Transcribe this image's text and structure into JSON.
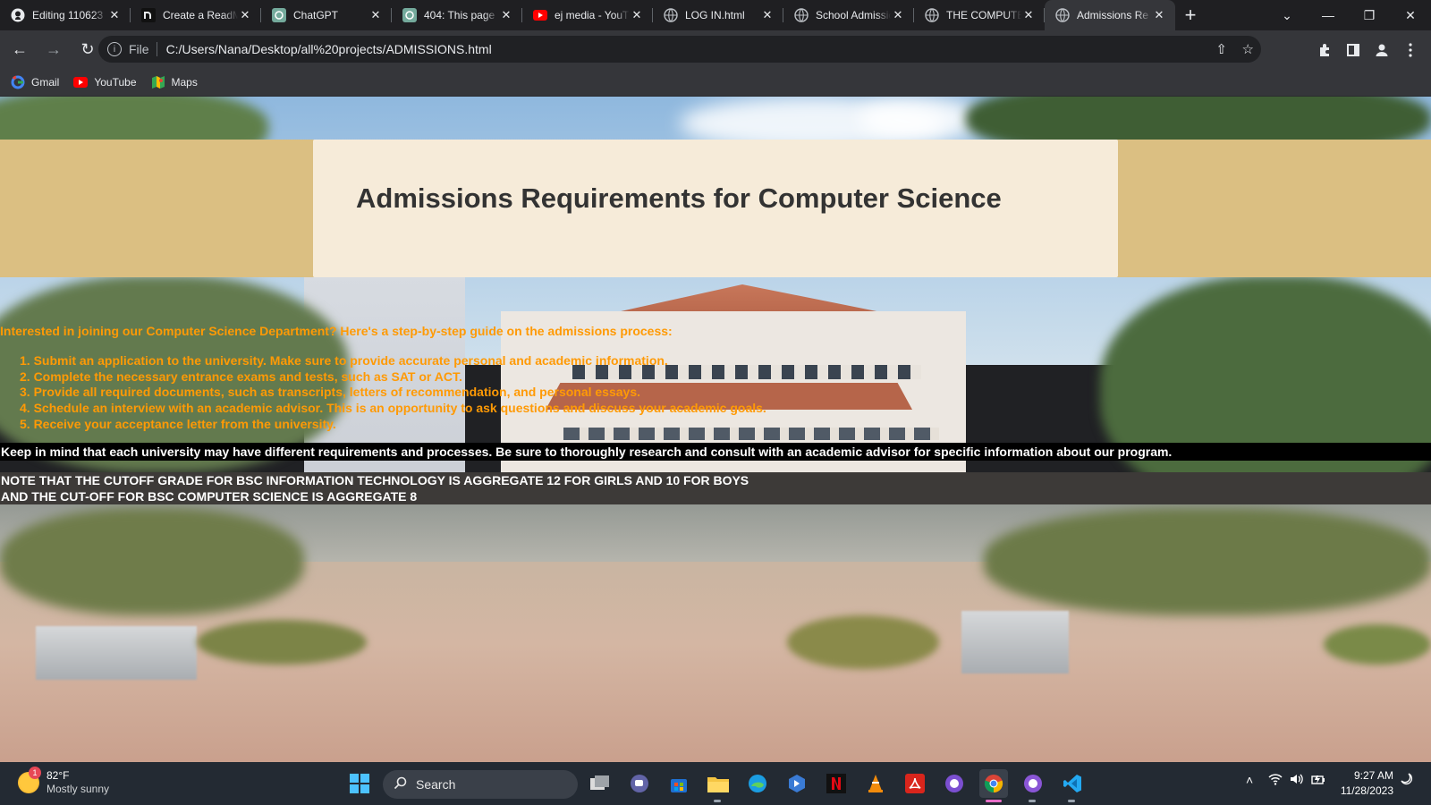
{
  "browser": {
    "tabs": [
      {
        "title": "Editing 110623",
        "favicon": "github-icon",
        "active": false
      },
      {
        "title": "Create a ReadMe",
        "favicon": "readme-icon",
        "active": false
      },
      {
        "title": "ChatGPT",
        "favicon": "chatgpt-icon",
        "active": false
      },
      {
        "title": "404: This page",
        "favicon": "chatgpt-icon",
        "active": false
      },
      {
        "title": "ej media - YouTube",
        "favicon": "youtube-icon",
        "active": false
      },
      {
        "title": "LOG IN.html",
        "favicon": "globe-icon",
        "active": false
      },
      {
        "title": "School Admission",
        "favicon": "globe-icon",
        "active": false
      },
      {
        "title": "THE COMPUTER",
        "favicon": "globe-icon",
        "active": false
      },
      {
        "title": "Admissions Re",
        "favicon": "globe-icon",
        "active": true
      }
    ],
    "address": {
      "scheme_label": "File",
      "url": "C:/Users/Nana/Desktop/all%20projects/ADMISSIONS.html"
    },
    "bookmarks": [
      {
        "label": "Gmail",
        "icon": "google-icon"
      },
      {
        "label": "YouTube",
        "icon": "youtube-icon"
      },
      {
        "label": "Maps",
        "icon": "maps-icon"
      }
    ]
  },
  "page": {
    "title": "Admissions Requirements for Computer Science",
    "intro": "Interested in joining our Computer Science Department? Here's a step-by-step guide on the admissions process:",
    "steps": [
      "1. Submit an application to the university. Make sure to provide accurate personal and academic information.",
      "2. Complete the necessary entrance exams and tests, such as SAT or ACT.",
      "3. Provide all required documents, such as transcripts, letters of recommendation, and personal essays.",
      "4. Schedule an interview with an academic advisor. This is an opportunity to ask questions and discuss your academic goals.",
      "5. Receive your acceptance letter from the university."
    ],
    "keep_in_mind": "Keep in mind that each university may have different requirements and processes. Be sure to thoroughly research and consult with an academic advisor for specific information about our program.",
    "note_line1": "NOTE THAT THE CUTOFF GRADE FOR BSC INFORMATION TECHNOLOGY IS AGGREGATE 12 FOR GIRLS AND 10 FOR BOYS",
    "note_line2": "AND THE CUT-OFF FOR BSC COMPUTER SCIENCE IS AGGREGATE 8",
    "colors": {
      "header_band": "#dbbf82",
      "header_card": "#f6ebd9",
      "orange_text": "#ff9a05"
    }
  },
  "taskbar": {
    "weather": {
      "temp": "82°F",
      "condition": "Mostly sunny",
      "badge": "1"
    },
    "search_label": "Search",
    "time": "9:27 AM",
    "date": "11/28/2023"
  }
}
